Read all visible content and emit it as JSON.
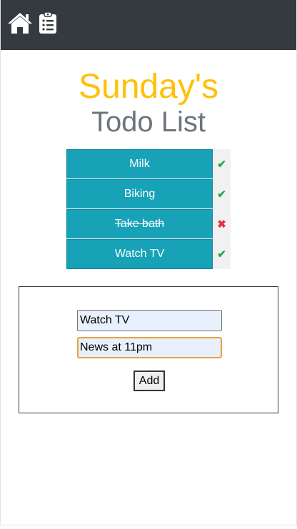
{
  "header": {
    "home_icon": "home-icon",
    "list_icon": "clipboard-list-icon",
    "background": "#343a40"
  },
  "title": {
    "day": "Sunday's",
    "subtitle": "Todo List"
  },
  "todos": [
    {
      "label": "Milk",
      "status": "✔",
      "done": false,
      "status_color": "#28a745"
    },
    {
      "label": "Biking",
      "status": "✔",
      "done": false,
      "status_color": "#28a745"
    },
    {
      "label": "Take bath",
      "status": "✖",
      "done": true,
      "status_color": "#dc3545"
    },
    {
      "label": "Watch TV",
      "status": "✔",
      "done": false,
      "status_color": "#28a745"
    }
  ],
  "form": {
    "field1_value": "Watch TV",
    "field2_value": "News at 11pm",
    "add_label": "Add"
  },
  "colors": {
    "title": "#ffc107",
    "subtitle": "#6c757d",
    "todo_bg": "#17a2b8"
  }
}
